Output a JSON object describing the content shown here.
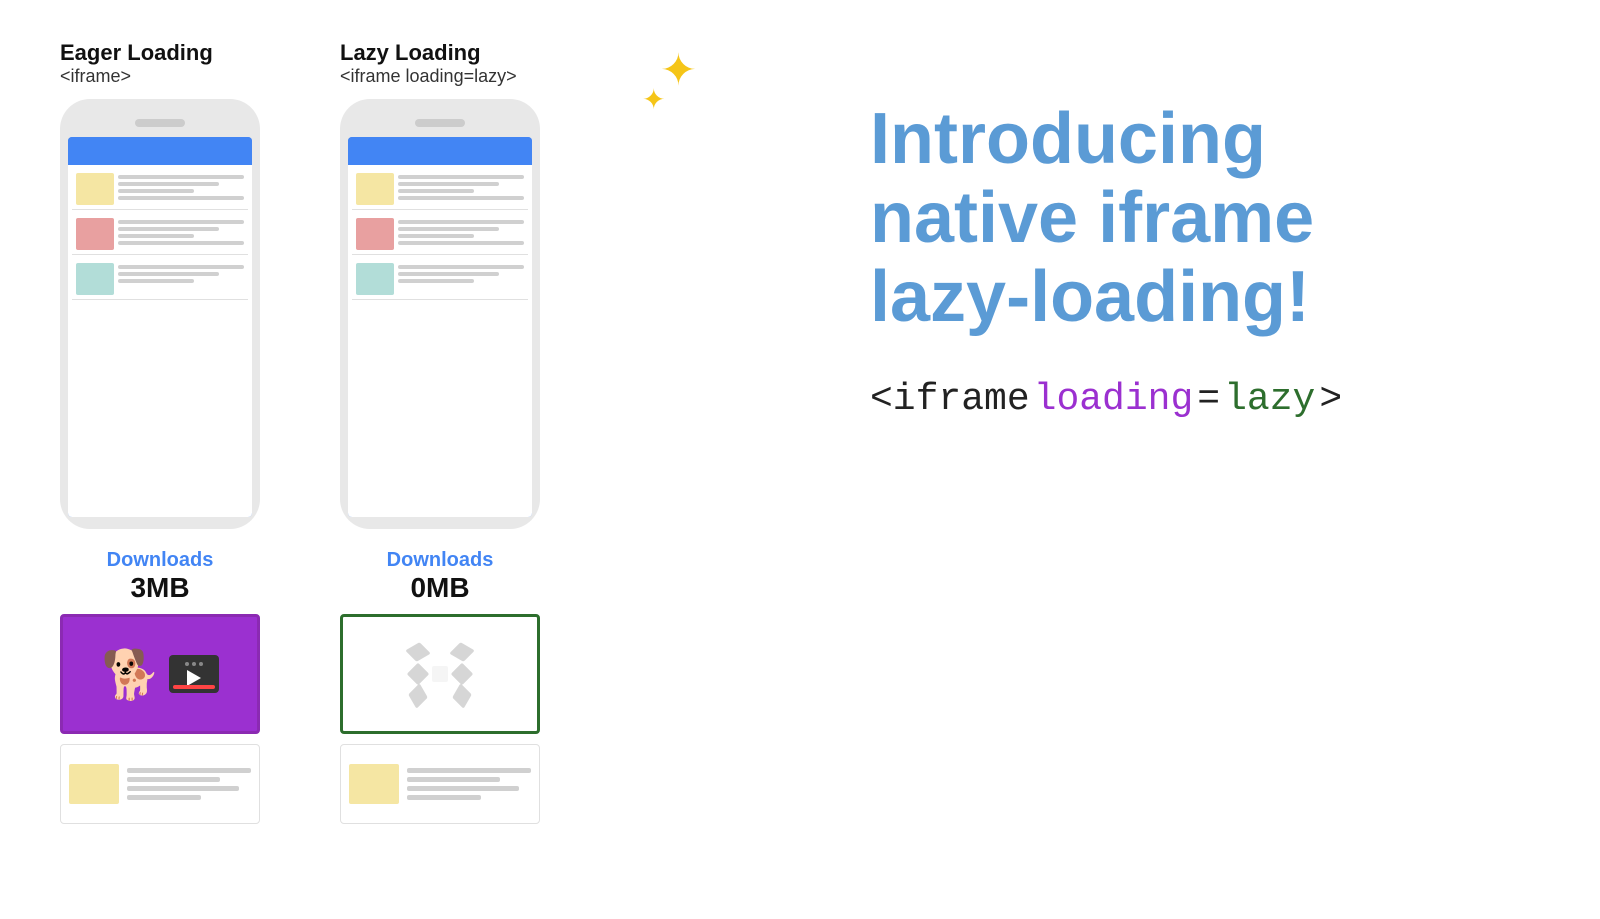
{
  "eager": {
    "title": "Eager Loading",
    "subtitle": "<iframe>",
    "downloads_label": "Downloads",
    "downloads_size": "3MB"
  },
  "lazy": {
    "title": "Lazy Loading",
    "subtitle": "<iframe loading=lazy>",
    "downloads_label": "Downloads",
    "downloads_size": "0MB"
  },
  "introducing": {
    "line1": "Introducing",
    "line2": "native iframe",
    "line3": "lazy-loading!"
  },
  "code": {
    "part1": "<iframe",
    "part2": "loading",
    "part3": "=",
    "part4": "lazy",
    "part5": ">"
  },
  "sparkle": "✦✦"
}
